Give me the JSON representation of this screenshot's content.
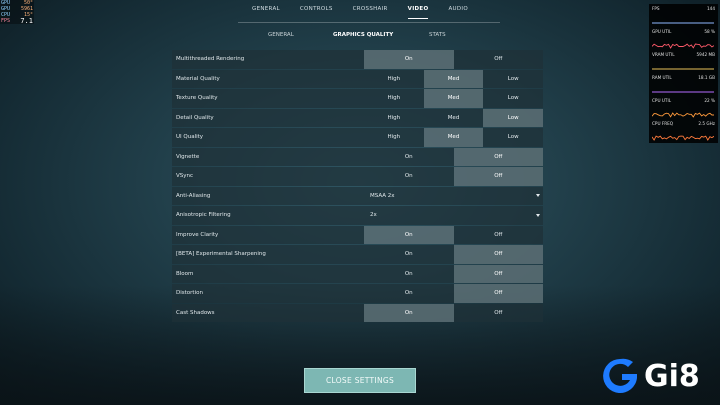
{
  "hud": {
    "rows": [
      {
        "k": "GPU",
        "v": "50°"
      },
      {
        "k": "GPU",
        "v": "5961"
      },
      {
        "k": "CPU",
        "v": "15°"
      },
      {
        "k": "FPS",
        "v": "7.1"
      }
    ]
  },
  "topnav": {
    "tabs": [
      "GENERAL",
      "CONTROLS",
      "CROSSHAIR",
      "VIDEO",
      "AUDIO"
    ],
    "active": "VIDEO"
  },
  "subnav": {
    "tabs": [
      "GENERAL",
      "GRAPHICS QUALITY",
      "STATS"
    ],
    "active": "GRAPHICS QUALITY"
  },
  "settings": [
    {
      "label": "Multithreaded Rendering",
      "options": [
        "On",
        "Off"
      ],
      "selected": "On"
    },
    {
      "label": "Material Quality",
      "options": [
        "High",
        "Med",
        "Low"
      ],
      "selected": "Med"
    },
    {
      "label": "Texture Quality",
      "options": [
        "High",
        "Med",
        "Low"
      ],
      "selected": "Med"
    },
    {
      "label": "Detail Quality",
      "options": [
        "High",
        "Med",
        "Low"
      ],
      "selected": "Low"
    },
    {
      "label": "UI Quality",
      "options": [
        "High",
        "Med",
        "Low"
      ],
      "selected": "Med"
    },
    {
      "label": "Vignette",
      "options": [
        "On",
        "Off"
      ],
      "selected": "Off"
    },
    {
      "label": "VSync",
      "options": [
        "On",
        "Off"
      ],
      "selected": "Off"
    },
    {
      "label": "Anti-Aliasing",
      "dropdown": "MSAA 2x"
    },
    {
      "label": "Anisotropic Filtering",
      "dropdown": "2x"
    },
    {
      "label": "Improve Clarity",
      "options": [
        "On",
        "Off"
      ],
      "selected": "On"
    },
    {
      "label": "[BETA] Experimental Sharpening",
      "options": [
        "On",
        "Off"
      ],
      "selected": "Off"
    },
    {
      "label": "Bloom",
      "options": [
        "On",
        "Off"
      ],
      "selected": "Off"
    },
    {
      "label": "Distortion",
      "options": [
        "On",
        "Off"
      ],
      "selected": "Off"
    },
    {
      "label": "Cast Shadows",
      "options": [
        "On",
        "Off"
      ],
      "selected": "On"
    }
  ],
  "close_button": "CLOSE SETTINGS",
  "perf": [
    {
      "label": "FPS",
      "value": "144",
      "color": "#8fb8ff"
    },
    {
      "label": "GPU UTIL",
      "value": "58 %",
      "color": "#ff5a6a"
    },
    {
      "label": "VRAM UTIL",
      "value": "5942 MB",
      "color": "#e8c15a"
    },
    {
      "label": "RAM UTIL",
      "value": "18.1 GB",
      "color": "#b56cff"
    },
    {
      "label": "CPU UTIL",
      "value": "22 %",
      "color": "#ff9a3c"
    },
    {
      "label": "CPU FREQ",
      "value": "2.5 GHz",
      "color": "#ff7a3c"
    }
  ],
  "logo": {
    "text": "Gi8",
    "accent": "#1e7bff"
  }
}
